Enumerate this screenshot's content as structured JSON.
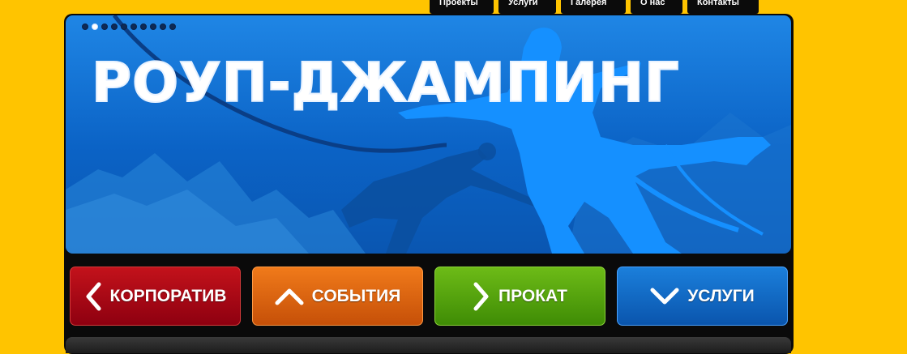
{
  "nav": {
    "items": [
      {
        "label": "Проекты"
      },
      {
        "label": "Услуги"
      },
      {
        "label": "Галерея"
      },
      {
        "label": "О нас"
      },
      {
        "label": "Контакты"
      }
    ]
  },
  "banner": {
    "title": "РОУП-ДЖАМПИНГ",
    "slide_count": 10,
    "active_slide": 2
  },
  "actions": [
    {
      "label": "КОРПОРАТИВ",
      "icon": "chevron-left-icon",
      "color": "#b0101a"
    },
    {
      "label": "СОБЫТИЯ",
      "icon": "chevron-up-icon",
      "color": "#e46a12"
    },
    {
      "label": "ПРОКАТ",
      "icon": "chevron-right-icon",
      "color": "#5aa60f"
    },
    {
      "label": "УСЛУГИ",
      "icon": "chevron-down-icon",
      "color": "#1470cc"
    }
  ],
  "colors": {
    "page_background": "#ffc400",
    "frame": "#0a0a0a",
    "banner_blue": "#0b63c6"
  }
}
